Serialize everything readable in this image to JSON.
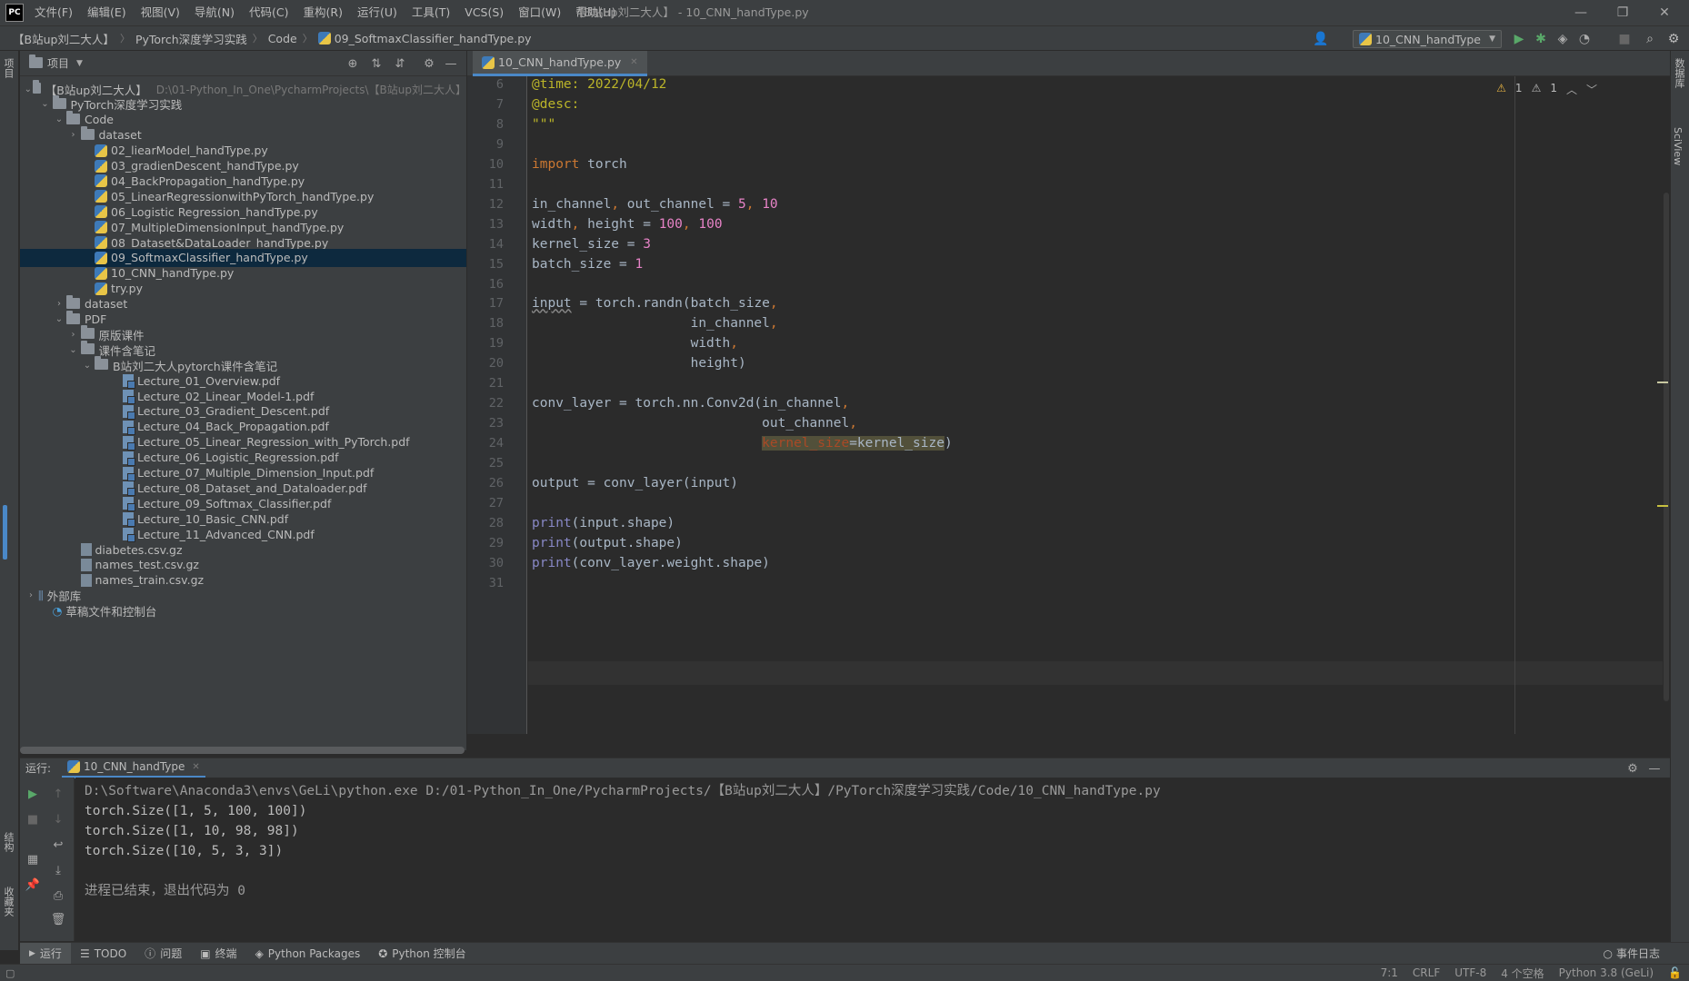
{
  "menubar": {
    "logo": "PC",
    "items": [
      "文件(F)",
      "编辑(E)",
      "视图(V)",
      "导航(N)",
      "代码(C)",
      "重构(R)",
      "运行(U)",
      "工具(T)",
      "VCS(S)",
      "窗口(W)",
      "帮助(H)"
    ],
    "window_title": "【B站up刘二大人】 - 10_CNN_handType.py"
  },
  "navbar": {
    "crumbs": [
      "【B站up刘二大人】",
      "PyTorch深度学习实践",
      "Code",
      "09_SoftmaxClassifier_handType.py"
    ],
    "run_config": "10_CNN_handType"
  },
  "left_strip": {
    "top_tab": "项目",
    "bottom_tabs": [
      "结构",
      "收藏夹"
    ]
  },
  "right_strip": {
    "tabs": [
      "数据库",
      "SciView"
    ]
  },
  "project": {
    "header": "项目",
    "tree": [
      {
        "label": "【B站up刘二大人】",
        "path": "D:\\01-Python_In_One\\PycharmProjects\\【B站up刘二大人】",
        "kind": "folder",
        "indent": 0,
        "arrow": "open"
      },
      {
        "label": "PyTorch深度学习实践",
        "kind": "folder",
        "indent": 1,
        "arrow": "open"
      },
      {
        "label": "Code",
        "kind": "folder",
        "indent": 2,
        "arrow": "open"
      },
      {
        "label": "dataset",
        "kind": "folder",
        "indent": 3,
        "arrow": "closed"
      },
      {
        "label": "02_liearModel_handType.py",
        "kind": "py",
        "indent": 4
      },
      {
        "label": "03_gradienDescent_handType.py",
        "kind": "py",
        "indent": 4
      },
      {
        "label": "04_BackPropagation_handType.py",
        "kind": "py",
        "indent": 4
      },
      {
        "label": "05_LinearRegressionwithPyTorch_handType.py",
        "kind": "py",
        "indent": 4
      },
      {
        "label": "06_Logistic Regression_handType.py",
        "kind": "py",
        "indent": 4
      },
      {
        "label": "07_MultipleDimensionInput_handType.py",
        "kind": "py",
        "indent": 4
      },
      {
        "label": "08_Dataset&DataLoader_handType.py",
        "kind": "py",
        "indent": 4
      },
      {
        "label": "09_SoftmaxClassifier_handType.py",
        "kind": "py",
        "indent": 4,
        "selected": true
      },
      {
        "label": "10_CNN_handType.py",
        "kind": "py",
        "indent": 4
      },
      {
        "label": "try.py",
        "kind": "py",
        "indent": 4
      },
      {
        "label": "dataset",
        "kind": "folder",
        "indent": 2,
        "arrow": "closed"
      },
      {
        "label": "PDF",
        "kind": "folder",
        "indent": 2,
        "arrow": "open"
      },
      {
        "label": "原版课件",
        "kind": "folder",
        "indent": 3,
        "arrow": "closed"
      },
      {
        "label": "课件含笔记",
        "kind": "folder",
        "indent": 3,
        "arrow": "open"
      },
      {
        "label": "B站刘二大人pytorch课件含笔记",
        "kind": "folder",
        "indent": 4,
        "arrow": "open"
      },
      {
        "label": "Lecture_01_Overview.pdf",
        "kind": "pdf",
        "indent": 6
      },
      {
        "label": "Lecture_02_Linear_Model-1.pdf",
        "kind": "pdf",
        "indent": 6
      },
      {
        "label": "Lecture_03_Gradient_Descent.pdf",
        "kind": "pdf",
        "indent": 6
      },
      {
        "label": "Lecture_04_Back_Propagation.pdf",
        "kind": "pdf",
        "indent": 6
      },
      {
        "label": "Lecture_05_Linear_Regression_with_PyTorch.pdf",
        "kind": "pdf",
        "indent": 6
      },
      {
        "label": "Lecture_06_Logistic_Regression.pdf",
        "kind": "pdf",
        "indent": 6
      },
      {
        "label": "Lecture_07_Multiple_Dimension_Input.pdf",
        "kind": "pdf",
        "indent": 6
      },
      {
        "label": "Lecture_08_Dataset_and_Dataloader.pdf",
        "kind": "pdf",
        "indent": 6
      },
      {
        "label": "Lecture_09_Softmax_Classifier.pdf",
        "kind": "pdf",
        "indent": 6
      },
      {
        "label": "Lecture_10_Basic_CNN.pdf",
        "kind": "pdf",
        "indent": 6
      },
      {
        "label": "Lecture_11_Advanced_CNN.pdf",
        "kind": "pdf",
        "indent": 6
      },
      {
        "label": "diabetes.csv.gz",
        "kind": "gz",
        "indent": 3
      },
      {
        "label": "names_test.csv.gz",
        "kind": "gz",
        "indent": 3
      },
      {
        "label": "names_train.csv.gz",
        "kind": "gz",
        "indent": 3
      },
      {
        "label": "外部库",
        "kind": "lib",
        "indent": 0,
        "arrow": "closed"
      },
      {
        "label": "草稿文件和控制台",
        "kind": "scratch",
        "indent": 1
      }
    ]
  },
  "editor": {
    "tab": "10_CNN_handType.py",
    "inspections": [
      "1",
      "1"
    ],
    "lines": [
      {
        "n": "6",
        "html": "<span class='doc'>@time: 2022/04/12</span>"
      },
      {
        "n": "7",
        "html": "<span class='doc'>@desc:</span>"
      },
      {
        "n": "8",
        "html": "<span class='doc'>\"\"\"</span>"
      },
      {
        "n": "9",
        "html": ""
      },
      {
        "n": "10",
        "html": "<span class='kw'>import</span> torch"
      },
      {
        "n": "11",
        "html": ""
      },
      {
        "n": "12",
        "html": "in_channel<span class='kw'>,</span> out_channel = <span class='pink'>5</span><span class='kw'>,</span> <span class='pink'>10</span>"
      },
      {
        "n": "13",
        "html": "width<span class='kw'>,</span> height = <span class='pink'>100</span><span class='kw'>,</span> <span class='pink'>100</span>"
      },
      {
        "n": "14",
        "html": "kernel_size = <span class='pink'>3</span>"
      },
      {
        "n": "15",
        "html": "batch_size = <span class='pink'>1</span>"
      },
      {
        "n": "16",
        "html": ""
      },
      {
        "n": "17",
        "html": "<span style='text-decoration:underline wavy #888'>input</span> = torch.randn(batch_size<span class='kw'>,</span>"
      },
      {
        "n": "18",
        "html": "                    in_channel<span class='kw'>,</span>"
      },
      {
        "n": "19",
        "html": "                    width<span class='kw'>,</span>"
      },
      {
        "n": "20",
        "html": "                    height)"
      },
      {
        "n": "21",
        "html": ""
      },
      {
        "n": "22",
        "html": "conv_layer = torch.nn.Conv2d(in_channel<span class='kw'>,</span>"
      },
      {
        "n": "23",
        "html": "                             out_channel<span class='kw'>,</span>"
      },
      {
        "n": "24",
        "html": "                             <span class='paramhl'>kernel_size</span><span style='background:#52503a'>=kernel_size</span>)"
      },
      {
        "n": "25",
        "html": ""
      },
      {
        "n": "26",
        "html": "output = conv_layer(input)"
      },
      {
        "n": "27",
        "html": ""
      },
      {
        "n": "28",
        "html": "<span class='bi'>print</span>(input.shape)"
      },
      {
        "n": "29",
        "html": "<span class='bi'>print</span>(output.shape)"
      },
      {
        "n": "30",
        "html": "<span class='bi'>print</span>(conv_layer.weight.shape)"
      },
      {
        "n": "31",
        "html": ""
      }
    ]
  },
  "run": {
    "label": "运行:",
    "tab": "10_CNN_handType",
    "console": [
      "D:\\Software\\Anaconda3\\envs\\GeLi\\python.exe D:/01-Python_In_One/PycharmProjects/【B站up刘二大人】/PyTorch深度学习实践/Code/10_CNN_handType.py",
      "torch.Size([1, 5, 100, 100])",
      "torch.Size([1, 10, 98, 98])",
      "torch.Size([10, 5, 3, 3])",
      "",
      "进程已结束，退出代码为 0"
    ]
  },
  "tool_tabs": [
    "运行",
    "TODO",
    "问题",
    "终端",
    "Python Packages",
    "Python 控制台"
  ],
  "event_log": "事件日志",
  "status": [
    "7:1",
    "CRLF",
    "UTF-8",
    "4 个空格",
    "Python 3.8 (GeLi)"
  ]
}
